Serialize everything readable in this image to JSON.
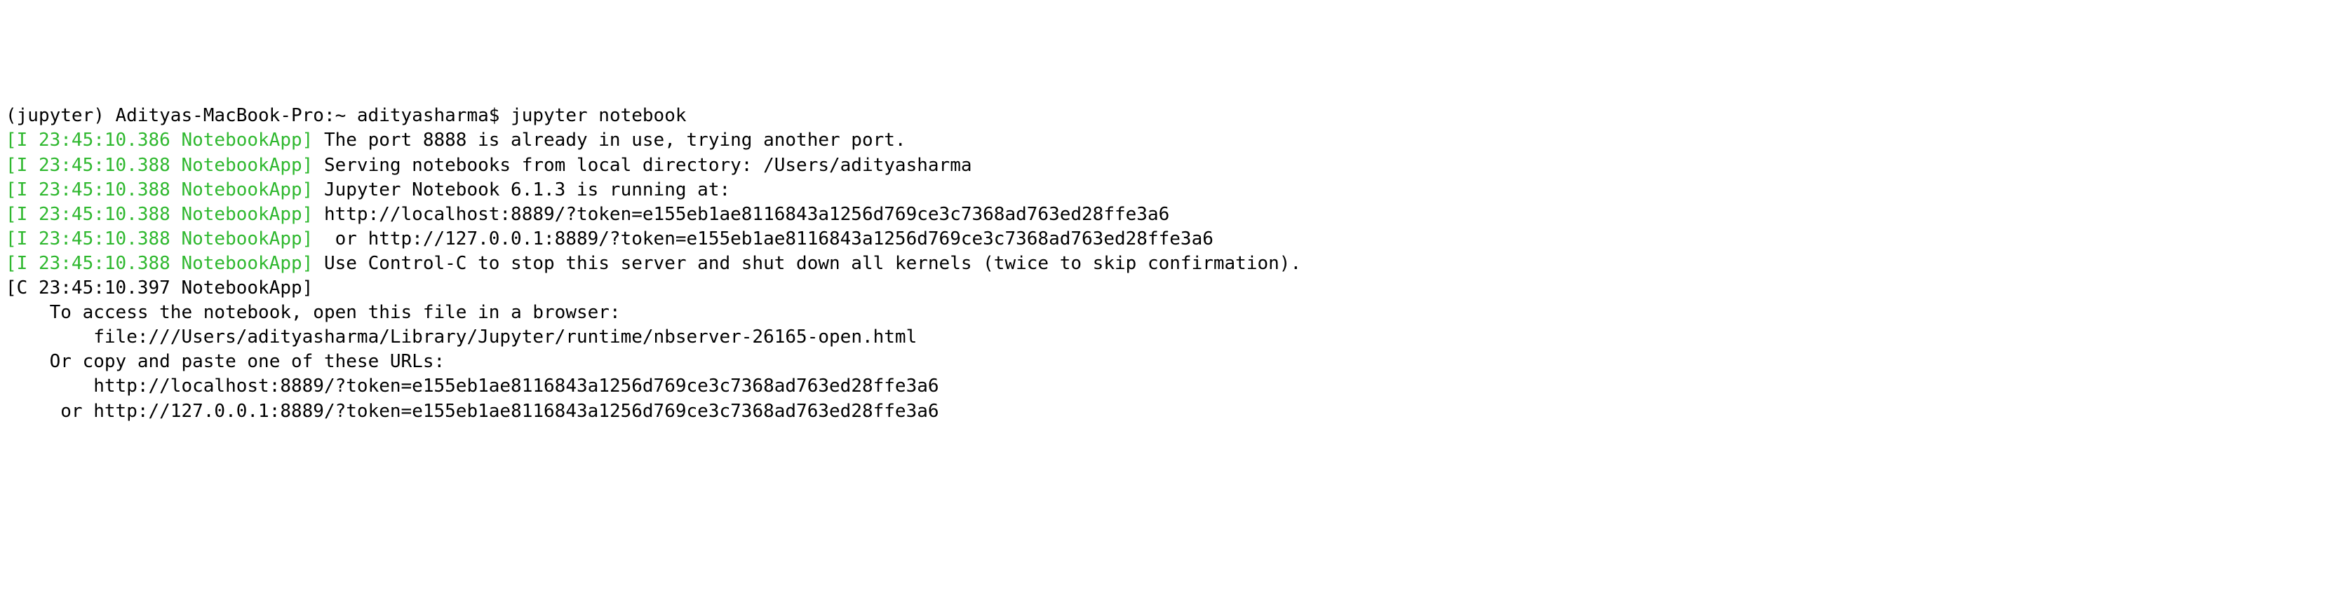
{
  "prompt": "(jupyter) Adityas-MacBook-Pro:~ adityasharma$ ",
  "command": "jupyter notebook",
  "log": [
    {
      "tag": "[I 23:45:10.386 NotebookApp]",
      "msg": " The port 8888 is already in use, trying another port."
    },
    {
      "tag": "[I 23:45:10.388 NotebookApp]",
      "msg": " Serving notebooks from local directory: /Users/adityasharma"
    },
    {
      "tag": "[I 23:45:10.388 NotebookApp]",
      "msg": " Jupyter Notebook 6.1.3 is running at:"
    },
    {
      "tag": "[I 23:45:10.388 NotebookApp]",
      "msg": " http://localhost:8889/?token=e155eb1ae8116843a1256d769ce3c7368ad763ed28ffe3a6"
    },
    {
      "tag": "[I 23:45:10.388 NotebookApp]",
      "msg": "  or http://127.0.0.1:8889/?token=e155eb1ae8116843a1256d769ce3c7368ad763ed28ffe3a6"
    },
    {
      "tag": "[I 23:45:10.388 NotebookApp]",
      "msg": " Use Control-C to stop this server and shut down all kernels (twice to skip confirmation)."
    }
  ],
  "crit_tag": "[C 23:45:10.397 NotebookApp]",
  "body_lines": [
    "",
    "    To access the notebook, open this file in a browser:",
    "        file:///Users/adityasharma/Library/Jupyter/runtime/nbserver-26165-open.html",
    "    Or copy and paste one of these URLs:",
    "        http://localhost:8889/?token=e155eb1ae8116843a1256d769ce3c7368ad763ed28ffe3a6",
    "     or http://127.0.0.1:8889/?token=e155eb1ae8116843a1256d769ce3c7368ad763ed28ffe3a6"
  ]
}
